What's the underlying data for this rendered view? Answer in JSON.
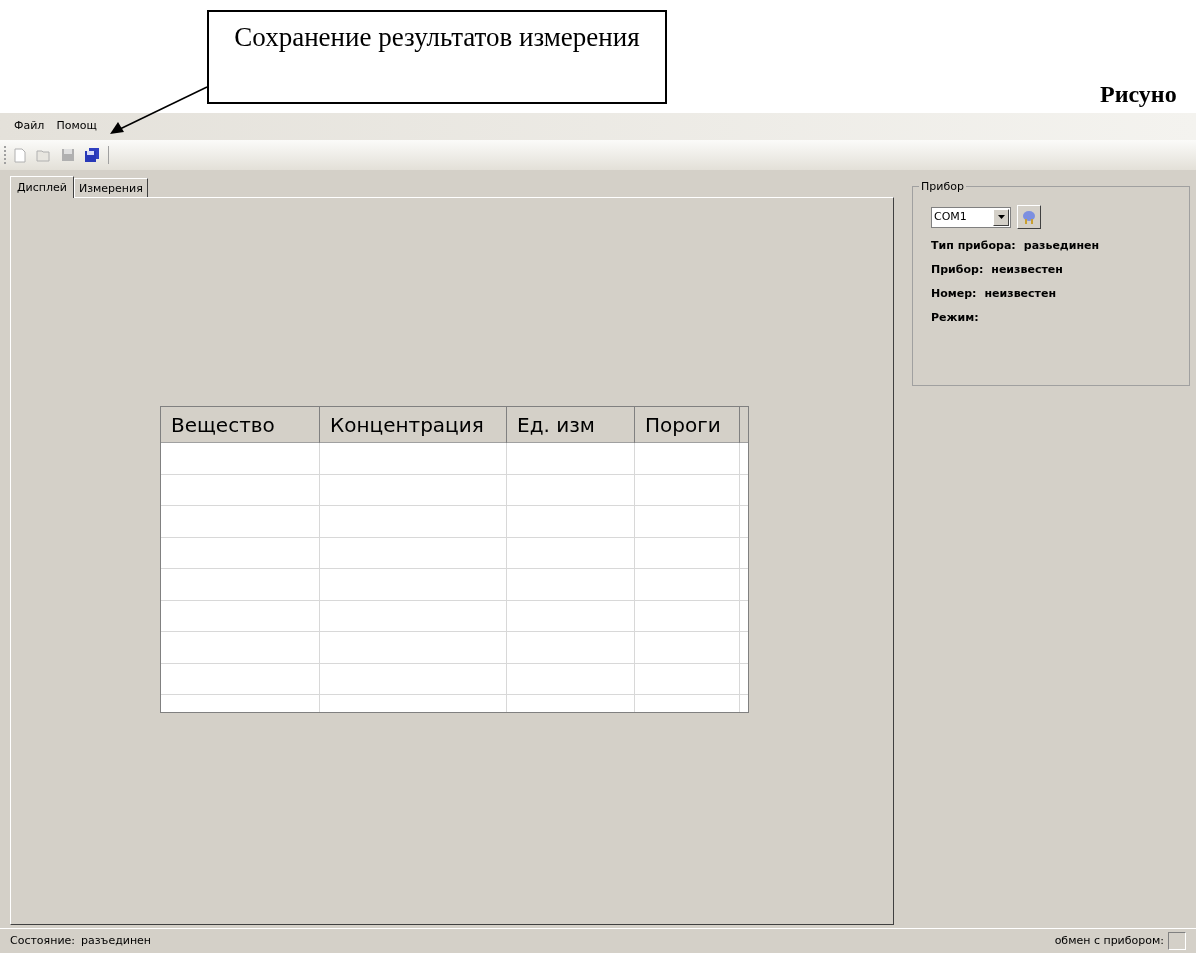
{
  "callout": {
    "text": "Сохранение результатов измерения"
  },
  "caption": "Рисуно",
  "menu": [
    "Файл",
    "Помощ"
  ],
  "toolbar": [
    {
      "kind": "new",
      "disabled": true
    },
    {
      "kind": "open",
      "disabled": true
    },
    {
      "kind": "save",
      "disabled": true
    },
    {
      "kind": "save-all",
      "disabled": false
    }
  ],
  "tabs": [
    {
      "label": "Дисплей",
      "selected": true
    },
    {
      "label": "Измерения",
      "selected": false
    }
  ],
  "table": {
    "columns": [
      "Вещество",
      "Концентрация",
      "Ед. изм",
      "Пороги"
    ]
  },
  "device_panel": {
    "title": "Прибор",
    "port": "COM1",
    "fields": [
      {
        "label": "Тип прибора:",
        "value": "разьединен"
      },
      {
        "label": "Прибор:",
        "value": "неизвестен"
      },
      {
        "label": "Номер:",
        "value": "неизвестен"
      },
      {
        "label": "Режим:"
      }
    ]
  },
  "status_bar": {
    "state_label": "Состояние:",
    "state_value": "разъединен",
    "exchange_label": "обмен с прибором:"
  }
}
